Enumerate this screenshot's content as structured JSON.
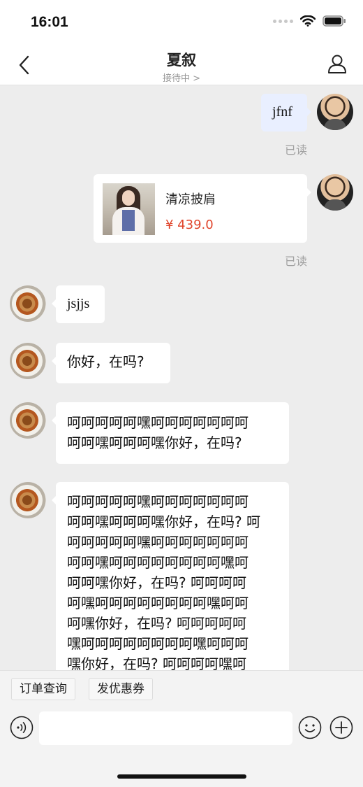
{
  "status_bar": {
    "time": "16:01"
  },
  "header": {
    "title": "夏叙",
    "subtitle": "接待中 >"
  },
  "messages": [
    {
      "sender": "agent",
      "text": "jfnf",
      "read_status": "已读"
    },
    {
      "sender": "agent",
      "type": "product",
      "product": {
        "name": "清凉披肩",
        "price": "¥ 439.0"
      },
      "read_status": "已读"
    },
    {
      "sender": "customer",
      "text": "jsjjs"
    },
    {
      "sender": "customer",
      "text": "你好，在吗?"
    },
    {
      "sender": "customer",
      "lines": [
        "呵呵呵呵呵嘿呵呵呵呵呵呵呵",
        "呵呵嘿呵呵呵嘿你好，在吗?"
      ]
    },
    {
      "sender": "customer",
      "lines": [
        "呵呵呵呵呵嘿呵呵呵呵呵呵呵",
        "呵呵嘿呵呵呵嘿你好，在吗? 呵",
        "呵呵呵呵呵嘿呵呵呵呵呵呵呵",
        "呵呵嘿呵呵呵呵呵呵呵呵嘿呵",
        "呵呵嘿你好，在吗? 呵呵呵呵",
        "呵嘿呵呵呵呵呵呵呵呵嘿呵呵",
        "呵嘿你好，在吗? 呵呵呵呵呵",
        "嘿呵呵呵呵呵呵呵呵嘿呵呵呵",
        "嘿你好，在吗? 呵呵呵呵嘿呵"
      ]
    }
  ],
  "quick_actions": [
    "订单查询",
    "发优惠券"
  ],
  "input": {
    "placeholder": ""
  },
  "colors": {
    "price": "#e0452c",
    "mine_bubble": "#e9efff",
    "background": "#ededed"
  }
}
